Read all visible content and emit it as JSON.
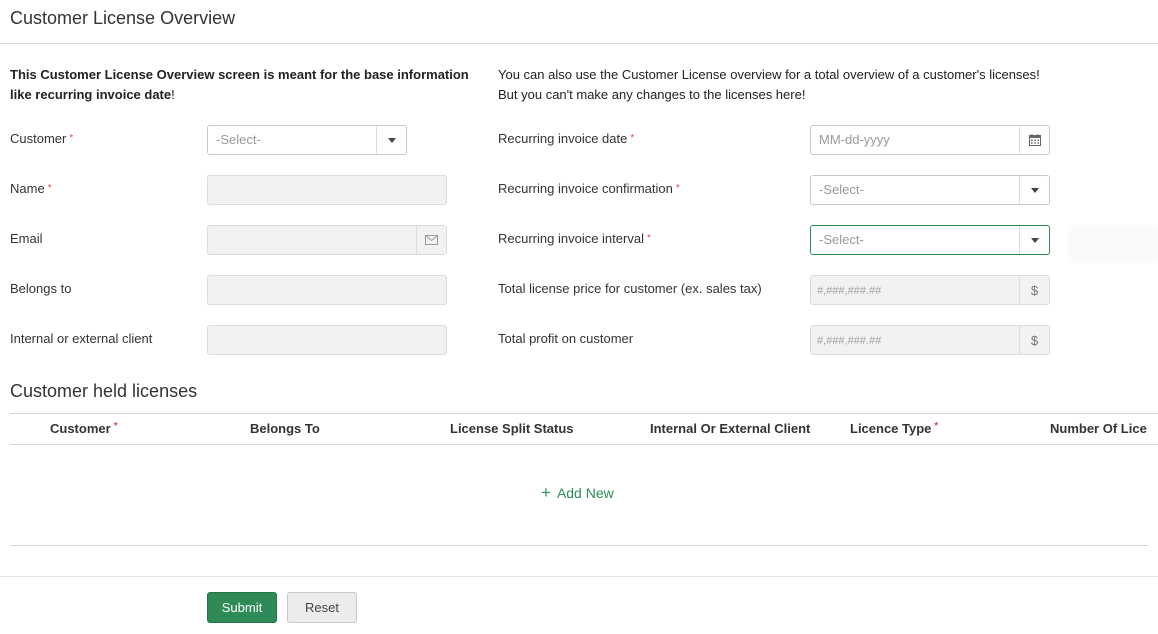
{
  "page": {
    "title": "Customer License Overview"
  },
  "intro": {
    "left_bold": "This Customer License Overview screen is meant for the base information like recurring invoice date",
    "left_tail": "!",
    "right_line1": "You can also use the Customer License overview for a total overview of a customer's licenses!",
    "right_line2": "But you can't make any changes to the licenses here!"
  },
  "form": {
    "required_mark": "*",
    "customer": {
      "label": "Customer",
      "placeholder": "-Select-"
    },
    "name": {
      "label": "Name",
      "value": ""
    },
    "email": {
      "label": "Email",
      "value": ""
    },
    "belongs_to": {
      "label": "Belongs to",
      "value": ""
    },
    "internal_external": {
      "label": "Internal or external client",
      "value": ""
    },
    "recurring_date": {
      "label": "Recurring invoice date",
      "placeholder": "MM-dd-yyyy"
    },
    "recurring_confirmation": {
      "label": "Recurring invoice confirmation",
      "placeholder": "-Select-"
    },
    "recurring_interval": {
      "label": "Recurring invoice interval",
      "placeholder": "-Select-"
    },
    "total_price": {
      "label": "Total license price for customer (ex. sales tax)",
      "placeholder": "#,###,###.##",
      "addon": "$"
    },
    "total_profit": {
      "label": "Total profit on customer",
      "placeholder": "#,###,###.##",
      "addon": "$"
    }
  },
  "licenses": {
    "title": "Customer held licenses",
    "columns": [
      {
        "label": "Customer",
        "required": "*"
      },
      {
        "label": "Belongs To",
        "required": ""
      },
      {
        "label": "License Split Status",
        "required": ""
      },
      {
        "label": "Internal Or External Client",
        "required": ""
      },
      {
        "label": "Licence Type",
        "required": "*"
      },
      {
        "label": "Number Of Lice",
        "required": ""
      }
    ],
    "add_new": "Add New"
  },
  "actions": {
    "submit": "Submit",
    "reset": "Reset"
  },
  "colors": {
    "accent": "#2e8b57",
    "required": "#d9534f"
  }
}
